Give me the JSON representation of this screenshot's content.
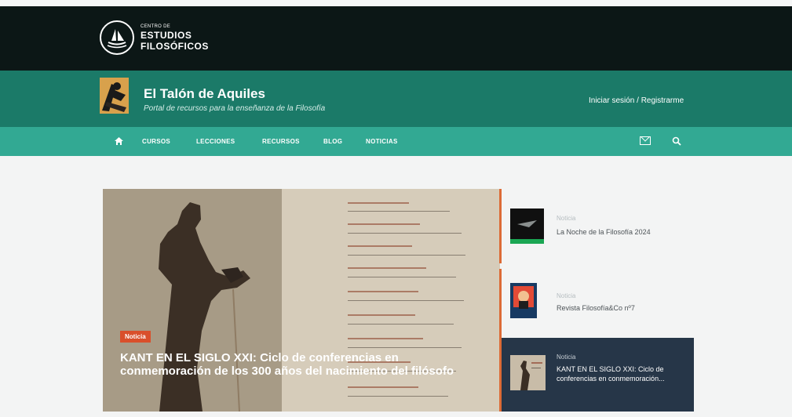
{
  "header": {
    "logo_small": "CENTRO DE",
    "logo_line1": "ESTUDIOS",
    "logo_line2": "FILOSÓFICOS",
    "site_title": "El Talón de Aquiles",
    "site_subtitle": "Portal de recursos para la enseñanza de la Filosofía",
    "login": "Iniciar sesión / Registrarme"
  },
  "nav": {
    "items": [
      "CURSOS",
      "LECCIONES",
      "RECURSOS",
      "BLOG",
      "NOTICIAS"
    ],
    "home_icon": "home-icon",
    "mail_icon": "mail-icon",
    "search_icon": "search-icon"
  },
  "featured": {
    "badge": "Noticia",
    "title": "KANT EN EL SIGLO XXI: Ciclo de conferencias en conmemoración de los 300 años del nacimiento del filósofo"
  },
  "sidebar": {
    "items": [
      {
        "label": "Noticia",
        "title": "La Noche de la Filosofía 2024"
      },
      {
        "label": "Noticia",
        "title": "Revista Filosofía&Co nº7"
      },
      {
        "label": "Noticia",
        "title": "KANT EN EL SIGLO XXI: Ciclo de conferencias en conmemoración..."
      }
    ]
  },
  "colors": {
    "top": "#0c1716",
    "header": "#1b7a68",
    "nav": "#32a993",
    "badge": "#d94f2b",
    "active": "#263648"
  }
}
